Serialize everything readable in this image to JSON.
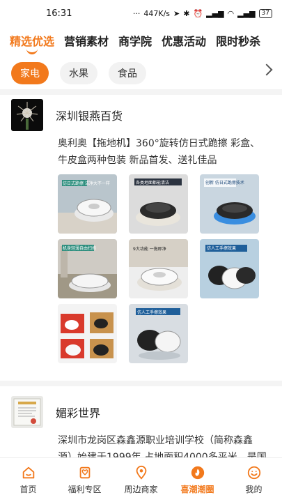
{
  "status": {
    "time": "16:31",
    "network_speed": "447K/s",
    "battery": "37"
  },
  "top_tabs": [
    {
      "label": "精选优选",
      "active": true
    },
    {
      "label": "营销素材",
      "active": false
    },
    {
      "label": "商学院",
      "active": false
    },
    {
      "label": "优惠活动",
      "active": false
    },
    {
      "label": "限时秒杀",
      "active": false
    }
  ],
  "categories": [
    {
      "label": "家电",
      "active": true
    },
    {
      "label": "水果",
      "active": false
    },
    {
      "label": "食品",
      "active": false
    }
  ],
  "posts": [
    {
      "store_name": "深圳银燕百货",
      "text": "奥利奥【拖地机】360°旋转仿日式跪擦 彩盒、牛皮盒两种包装 新品首发、送礼佳品",
      "thumbs": [
        {
          "caption": "仿日式跪擦 洁净大不一样"
        },
        {
          "caption": "各类地面都能清洁"
        },
        {
          "caption": "创新 仿日式跪擦技术"
        },
        {
          "caption": "机身轻薄自由扫拖"
        },
        {
          "caption": "9大功能 一拖即净"
        },
        {
          "caption": "仿人工手擦效果"
        },
        {
          "caption": ""
        },
        {
          "caption": "仿人工手擦效果"
        }
      ]
    },
    {
      "store_name": "媚彩世界",
      "text": "深圳市龙岗区森鑫源职业培训学校（简称森鑫源）始建于1999年 占地面积4000多平米，是国"
    }
  ],
  "bottom_nav": [
    {
      "label": "首页",
      "icon": "home-icon",
      "active": false
    },
    {
      "label": "福利专区",
      "icon": "gift-icon",
      "active": false
    },
    {
      "label": "周边商家",
      "icon": "location-icon",
      "active": false
    },
    {
      "label": "喜潮潮圈",
      "icon": "flame-icon",
      "active": true
    },
    {
      "label": "我的",
      "icon": "smile-icon",
      "active": false
    }
  ],
  "colors": {
    "accent": "#f2791c"
  }
}
